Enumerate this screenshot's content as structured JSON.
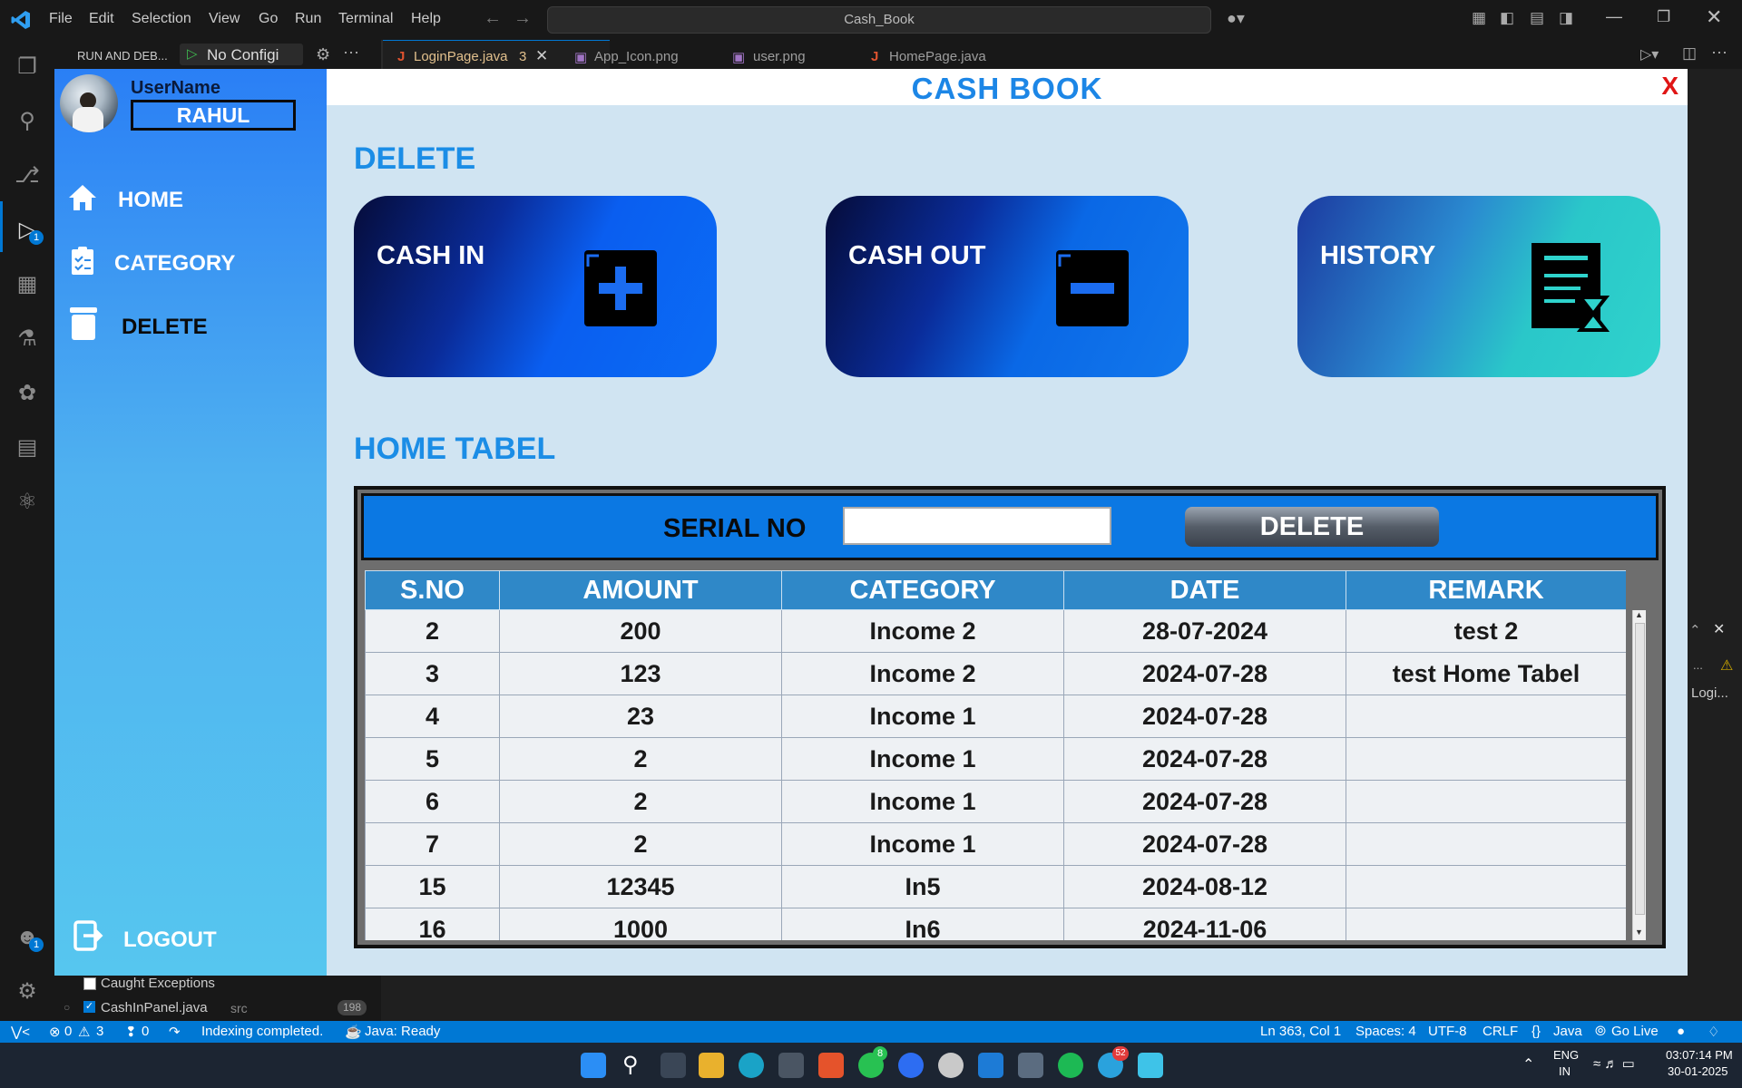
{
  "vscode": {
    "menu": [
      "File",
      "Edit",
      "Selection",
      "View",
      "Go",
      "Run",
      "Terminal",
      "Help"
    ],
    "search_text": "Cash_Book",
    "run_debug_label": "RUN AND DEB...",
    "config_label": "No Configi",
    "tabs": [
      {
        "label": "LoginPage.java",
        "badge": "3",
        "active": true
      },
      {
        "label": "App_Icon.png",
        "badge": ""
      },
      {
        "label": "user.png",
        "badge": ""
      },
      {
        "label": "HomePage.java",
        "badge": ""
      }
    ],
    "debug_badge": "1",
    "accounts_badge": "1",
    "breakpoints": {
      "caught_label": "Caught Exceptions",
      "file_label": "CashInPanel.java",
      "file_dir": "src",
      "file_line": "198"
    },
    "right_panel": {
      "item1": "Logi..."
    },
    "status": {
      "errors": "0",
      "warnings": "3",
      "ports": "0",
      "message": "Indexing completed.",
      "java_status": "Java: Ready",
      "position": "Ln 363, Col 1",
      "spaces": "Spaces: 4",
      "encoding": "UTF-8",
      "eol": "CRLF",
      "language": "Java",
      "golive": "Go Live"
    },
    "taskbar": {
      "lang": "ENG",
      "region": "IN",
      "time": "03:07:14 PM",
      "date": "30-01-2025",
      "whatsapp_badge": "8",
      "telegram_badge": "52"
    }
  },
  "app": {
    "title": "CASH BOOK",
    "close_label": "X",
    "user": {
      "label": "UserName",
      "name": "RAHUL"
    },
    "nav": [
      {
        "label": "HOME",
        "icon": "home-icon"
      },
      {
        "label": "CATEGORY",
        "icon": "category-icon"
      },
      {
        "label": "DELETE",
        "icon": "trash-icon"
      }
    ],
    "logout_label": "LOGOUT",
    "section_delete": "DELETE",
    "cards": [
      {
        "label": "CASH IN",
        "icon": "plus-icon"
      },
      {
        "label": "CASH OUT",
        "icon": "minus-icon"
      },
      {
        "label": "HISTORY",
        "icon": "history-icon"
      }
    ],
    "section_table": "HOME TABEL",
    "filter": {
      "serial_label": "SERIAL NO",
      "serial_value": "",
      "delete_label": "DELETE"
    },
    "table": {
      "headers": [
        "S.NO",
        "AMOUNT",
        "CATEGORY",
        "DATE",
        "REMARK"
      ],
      "rows": [
        [
          "2",
          "200",
          "Income 2",
          "28-07-2024",
          "test 2"
        ],
        [
          "3",
          "123",
          "Income 2",
          "2024-07-28",
          "test Home Tabel"
        ],
        [
          "4",
          "23",
          "Income 1",
          "2024-07-28",
          ""
        ],
        [
          "5",
          "2",
          "Income 1",
          "2024-07-28",
          ""
        ],
        [
          "6",
          "2",
          "Income 1",
          "2024-07-28",
          ""
        ],
        [
          "7",
          "2",
          "Income 1",
          "2024-07-28",
          ""
        ],
        [
          "15",
          "12345",
          "In5",
          "2024-08-12",
          ""
        ],
        [
          "16",
          "1000",
          "In6",
          "2024-11-06",
          ""
        ]
      ]
    },
    "colors": {
      "accent": "#1b8de6",
      "close": "#e01515",
      "sidebar_top": "#2a7ff5",
      "sidebar_bottom": "#56c6ef"
    }
  }
}
